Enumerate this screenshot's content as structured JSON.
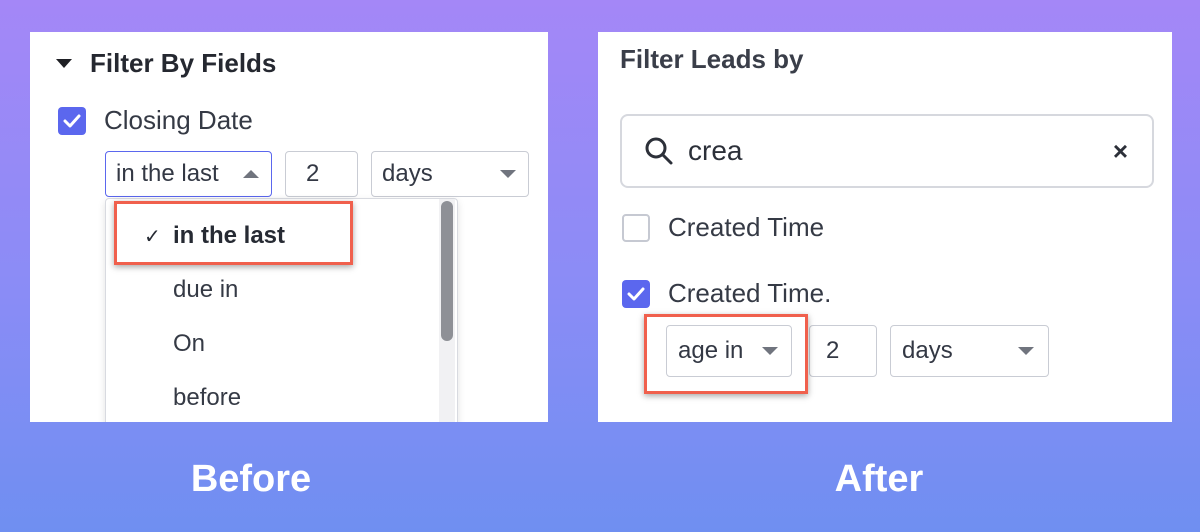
{
  "before": {
    "caption": "Before",
    "section_title": "Filter By Fields",
    "field_label": "Closing Date",
    "condition_select": "in the last",
    "amount_input": "2",
    "unit_select": "days",
    "dropdown_options": [
      {
        "label": "in the last",
        "selected": true
      },
      {
        "label": "due in",
        "selected": false
      },
      {
        "label": "On",
        "selected": false
      },
      {
        "label": "before",
        "selected": false
      }
    ],
    "check_mark": "✓"
  },
  "after": {
    "caption": "After",
    "filter_title": "Filter Leads by",
    "search_value": "crea",
    "clear_icon": "×",
    "field1_label": "Created Time",
    "field2_label": "Created Time.",
    "condition_select": "age in",
    "amount_input": "2",
    "unit_select": "days"
  },
  "colors": {
    "accent": "#5b67ee",
    "highlight": "#f0604d",
    "background_top": "#a487f7",
    "background_bottom": "#6f8ff1"
  }
}
